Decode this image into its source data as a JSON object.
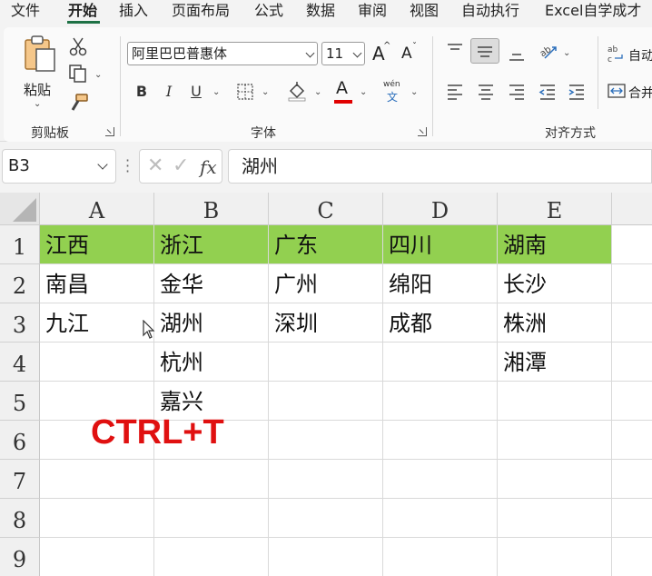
{
  "menu": {
    "tabs": [
      "文件",
      "开始",
      "插入",
      "页面布局",
      "公式",
      "数据",
      "审阅",
      "视图",
      "自动执行",
      "Excel自学成才"
    ],
    "active_tab": "开始"
  },
  "ribbon": {
    "clipboard": {
      "paste_label": "粘贴",
      "group_label": "剪贴板"
    },
    "font": {
      "font_name": "阿里巴巴普惠体",
      "font_size": "11",
      "grow_label": "A",
      "shrink_label": "A",
      "bold_label": "B",
      "italic_label": "I",
      "underline_label": "U",
      "font_color_label": "A",
      "pinyin_label": "wén",
      "pinyin_char": "文",
      "group_label": "字体",
      "font_color": "#e00000"
    },
    "alignment": {
      "wrap_label": "自动",
      "merge_label": "合并",
      "group_label": "对齐方式"
    }
  },
  "formula_bar": {
    "name_box": "B3",
    "formula": "湖州"
  },
  "sheet": {
    "columns": [
      "A",
      "B",
      "C",
      "D",
      "E"
    ],
    "rows": [
      "1",
      "2",
      "3",
      "4",
      "5",
      "6",
      "7",
      "8",
      "9"
    ],
    "header_fill": "#92d050",
    "cells": {
      "A1": "江西",
      "B1": "浙江",
      "C1": "广东",
      "D1": "四川",
      "E1": "湖南",
      "A2": "南昌",
      "B2": "金华",
      "C2": "广州",
      "D2": "绵阳",
      "E2": "长沙",
      "A3": "九江",
      "B3": "湖州",
      "C3": "深圳",
      "D3": "成都",
      "E3": "株洲",
      "B4": "杭州",
      "E4": "湘潭",
      "B5": "嘉兴"
    }
  },
  "overlay": {
    "shortcut": "CTRL+T",
    "color": "#e01010"
  }
}
